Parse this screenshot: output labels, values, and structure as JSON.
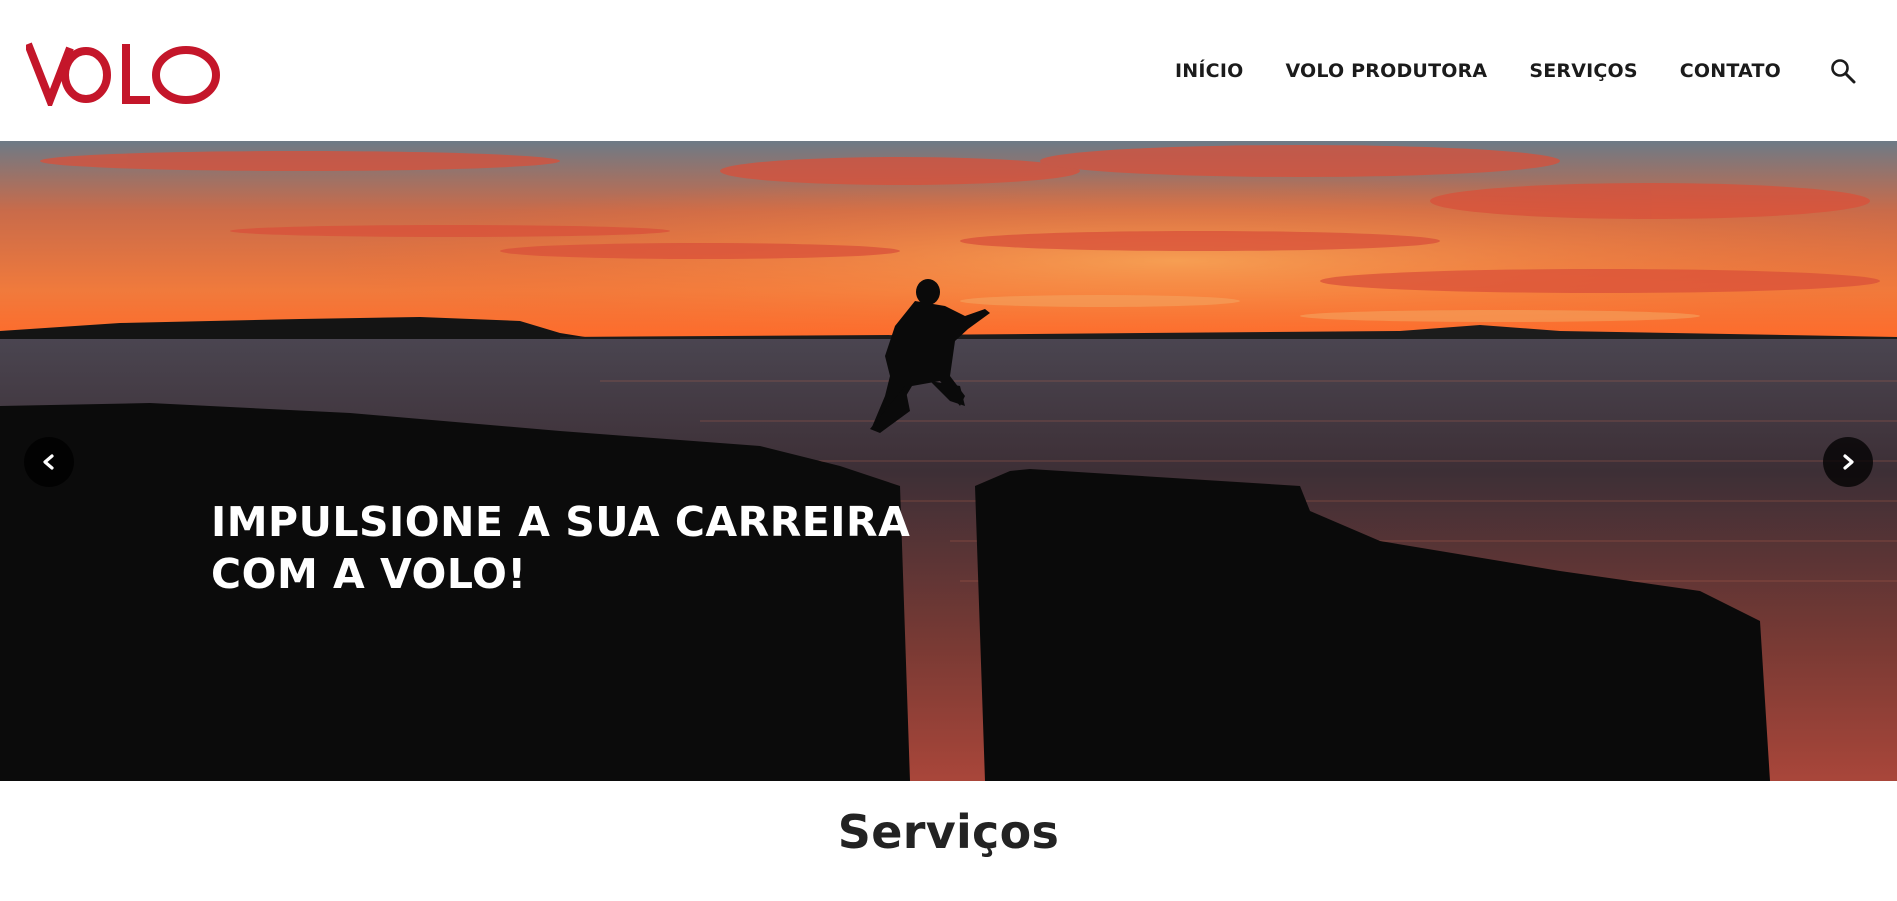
{
  "brand": {
    "logo_text": "VOLO",
    "color": "#c4162a"
  },
  "nav": {
    "items": [
      {
        "label": "INÍCIO"
      },
      {
        "label": "VOLO PRODUTORA"
      },
      {
        "label": "SERVIÇOS"
      },
      {
        "label": "CONTATO"
      }
    ],
    "search_icon": "search-icon"
  },
  "hero": {
    "title_line1": "IMPULSIONE A SUA CARREIRA",
    "title_line2": "COM A VOLO!",
    "prev_icon": "chevron-left-icon",
    "next_icon": "chevron-right-icon"
  },
  "section": {
    "title": "Serviços"
  }
}
